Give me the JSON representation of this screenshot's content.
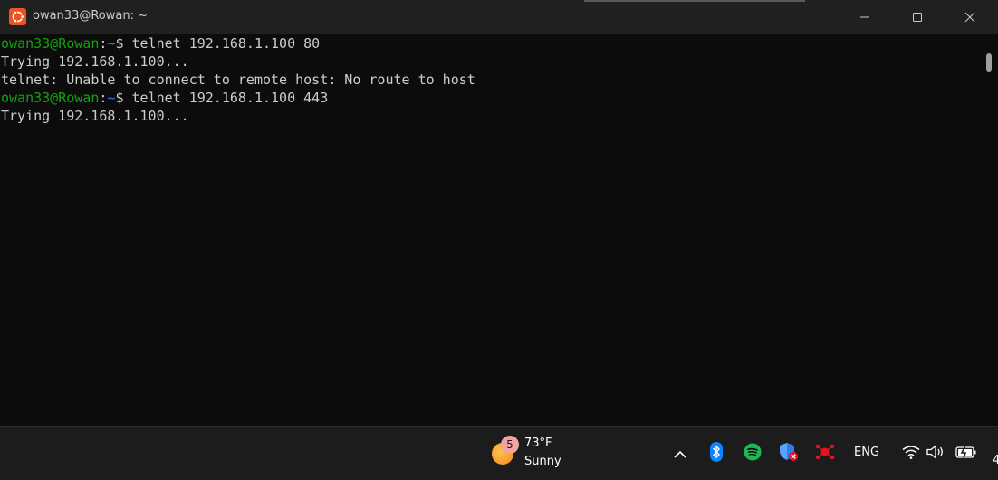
{
  "window": {
    "title": "owan33@Rowan: ~",
    "controls": {
      "minimize_icon": "minimize-icon",
      "maximize_icon": "maximize-icon",
      "close_icon": "close-icon"
    }
  },
  "terminal": {
    "lines": [
      {
        "type": "prompt",
        "user": "owan33@Rowan",
        "colon": ":",
        "path": "~",
        "dollar": "$ ",
        "command": "telnet 192.168.1.100 80"
      },
      {
        "type": "output",
        "text": "Trying 192.168.1.100..."
      },
      {
        "type": "output",
        "text": "telnet: Unable to connect to remote host: No route to host"
      },
      {
        "type": "prompt",
        "user": "owan33@Rowan",
        "colon": ":",
        "path": "~",
        "dollar": "$ ",
        "command": "telnet 192.168.1.100 443"
      },
      {
        "type": "output",
        "text": "Trying 192.168.1.100..."
      }
    ]
  },
  "taskbar": {
    "weather": {
      "badge": "5",
      "temperature": "73°F",
      "condition": "Sunny"
    },
    "tray": {
      "language": "ENG",
      "clock_fragment": "4"
    }
  },
  "colors": {
    "prompt_user": "#13a10e",
    "prompt_path": "#3b78ff",
    "text": "#cccccc",
    "background": "#0c0c0c",
    "ubuntu_orange": "#e95420",
    "spotify_green": "#1db954",
    "bluetooth_blue": "#0a84ff"
  }
}
